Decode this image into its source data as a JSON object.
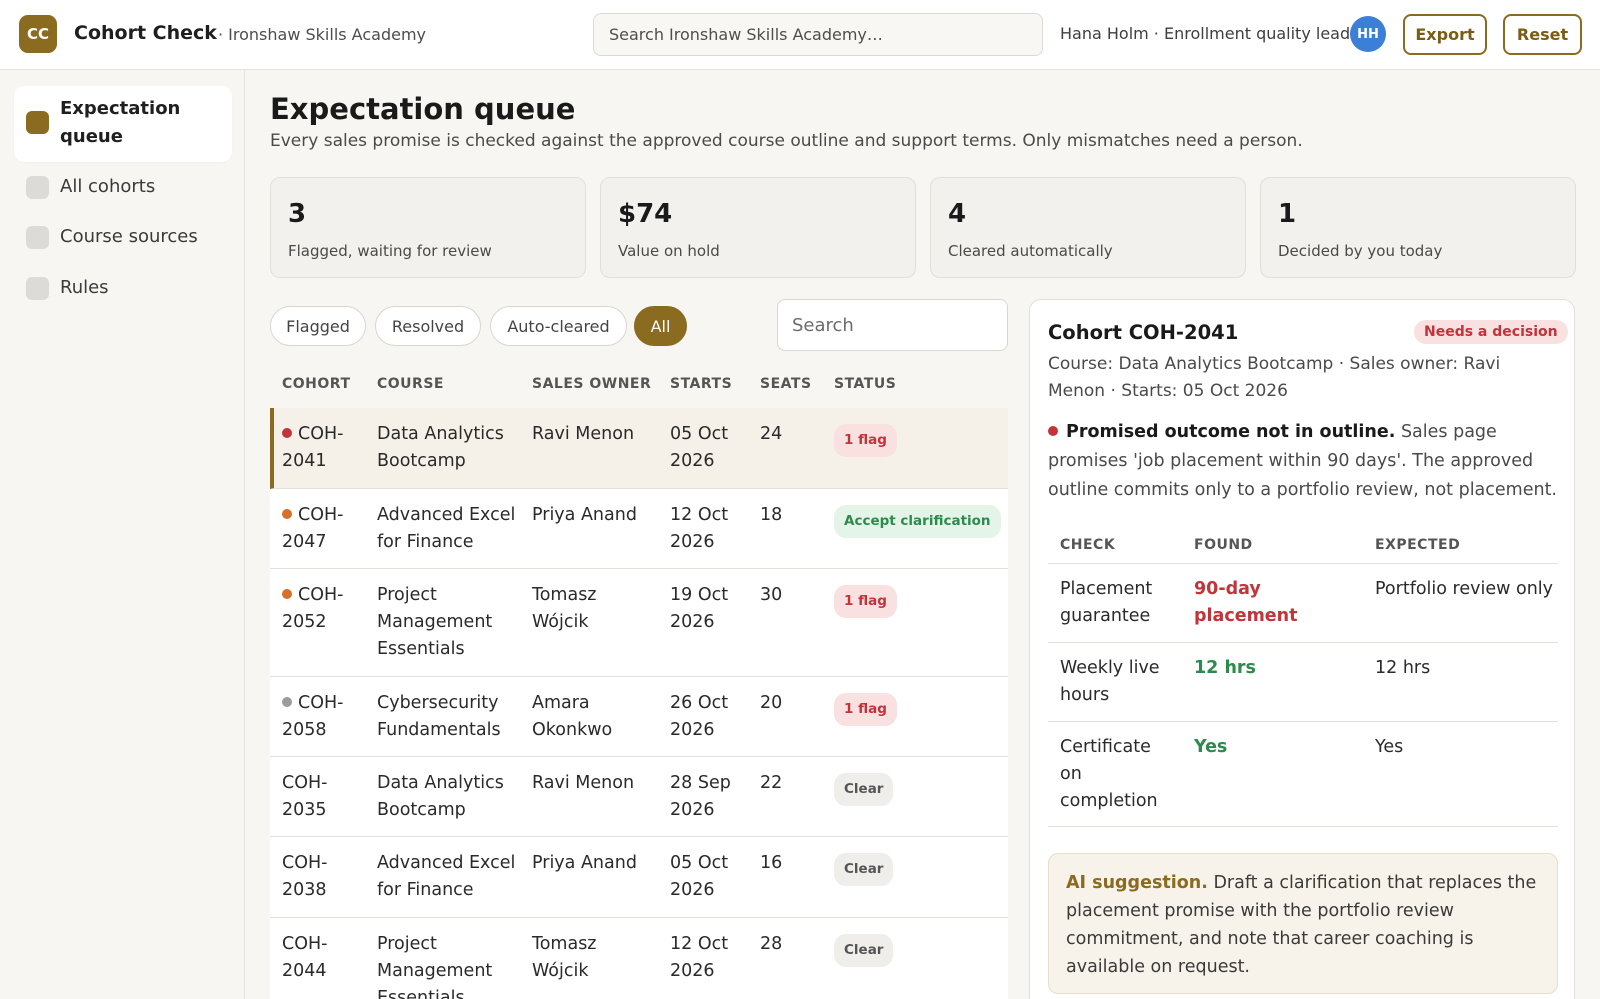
{
  "header": {
    "logo": "CC",
    "app_name": "Cohort Check",
    "org_name": "· Ironshaw Skills Academy",
    "search_placeholder": "Search Ironshaw Skills Academy…",
    "user_label": "Hana Holm · Enrollment quality lead",
    "avatar": "HH",
    "export_label": "Export",
    "reset_label": "Reset"
  },
  "sidebar": {
    "items": [
      {
        "label": "Expectation queue",
        "active": true
      },
      {
        "label": "All cohorts"
      },
      {
        "label": "Course sources"
      },
      {
        "label": "Rules"
      }
    ]
  },
  "main": {
    "title": "Expectation queue",
    "subtitle": "Every sales promise is checked against the approved course outline and support terms. Only mismatches need a person.",
    "stats": [
      {
        "value": "3",
        "caption": "Flagged, waiting for review"
      },
      {
        "value": "$74",
        "caption": "Value on hold"
      },
      {
        "value": "4",
        "caption": "Cleared automatically"
      },
      {
        "value": "1",
        "caption": "Decided by you today"
      }
    ],
    "filters": [
      "Flagged",
      "Resolved",
      "Auto-cleared",
      "All"
    ],
    "active_filter": "All",
    "table_search_placeholder": "Search",
    "columns": [
      "COHORT",
      "COURSE",
      "SALES OWNER",
      "STARTS",
      "SEATS",
      "STATUS"
    ],
    "rows": [
      {
        "cohort": "COH-2041",
        "course": "Data Analytics Bootcamp",
        "owner": "Ravi Menon",
        "starts": "05 Oct 2026",
        "seats": "24",
        "status": "1 flag",
        "status_kind": "flag",
        "dot": "#c0343a",
        "selected": true
      },
      {
        "cohort": "COH-2047",
        "course": "Advanced Excel for Finance",
        "owner": "Priya Anand",
        "starts": "12 Oct 2026",
        "seats": "18",
        "status": "Accept clarification",
        "status_kind": "accept",
        "dot": "#d4702a"
      },
      {
        "cohort": "COH-2052",
        "course": "Project Management Essentials",
        "owner": "Tomasz Wójcik",
        "starts": "19 Oct 2026",
        "seats": "30",
        "status": "1 flag",
        "status_kind": "flag",
        "dot": "#d4702a"
      },
      {
        "cohort": "COH-2058",
        "course": "Cybersecurity Fundamentals",
        "owner": "Amara Okonkwo",
        "starts": "26 Oct 2026",
        "seats": "20",
        "status": "1 flag",
        "status_kind": "flag",
        "dot": "#9b9b9b"
      },
      {
        "cohort": "COH-2035",
        "course": "Data Analytics Bootcamp",
        "owner": "Ravi Menon",
        "starts": "28 Sep 2026",
        "seats": "22",
        "status": "Clear",
        "status_kind": "clear"
      },
      {
        "cohort": "COH-2038",
        "course": "Advanced Excel for Finance",
        "owner": "Priya Anand",
        "starts": "05 Oct 2026",
        "seats": "16",
        "status": "Clear",
        "status_kind": "clear"
      },
      {
        "cohort": "COH-2044",
        "course": "Project Management Essentials",
        "owner": "Tomasz Wójcik",
        "starts": "12 Oct 2026",
        "seats": "28",
        "status": "Clear",
        "status_kind": "clear"
      }
    ]
  },
  "detail": {
    "title": "Cohort COH-2041",
    "badge": "Needs a decision",
    "meta": "Course: Data Analytics Bootcamp · Sales owner: Ravi Menon · Starts: 05 Oct 2026",
    "finding_title": "Promised outcome not in outline.",
    "finding_text": "Sales page promises 'job placement within 90 days'. The approved outline commits only to a portfolio review, not placement.",
    "columns": [
      "CHECK",
      "FOUND",
      "EXPECTED"
    ],
    "checks": [
      {
        "check": "Placement guarantee",
        "found": "90-day placement",
        "expected": "Portfolio review only",
        "ok": false
      },
      {
        "check": "Weekly live hours",
        "found": "12 hrs",
        "expected": "12 hrs",
        "ok": true
      },
      {
        "check": "Certificate on completion",
        "found": "Yes",
        "expected": "Yes",
        "ok": true
      }
    ],
    "ai_label": "AI suggestion.",
    "ai_text": "Draft a clarification that replaces the placement promise with the portfolio review commitment, and note that career coaching is available on request."
  },
  "colors": {
    "accent": "#8b6b1f",
    "flag": "#c0343a",
    "ok": "#2e8a4c",
    "avatar": "#3b7fd6"
  }
}
